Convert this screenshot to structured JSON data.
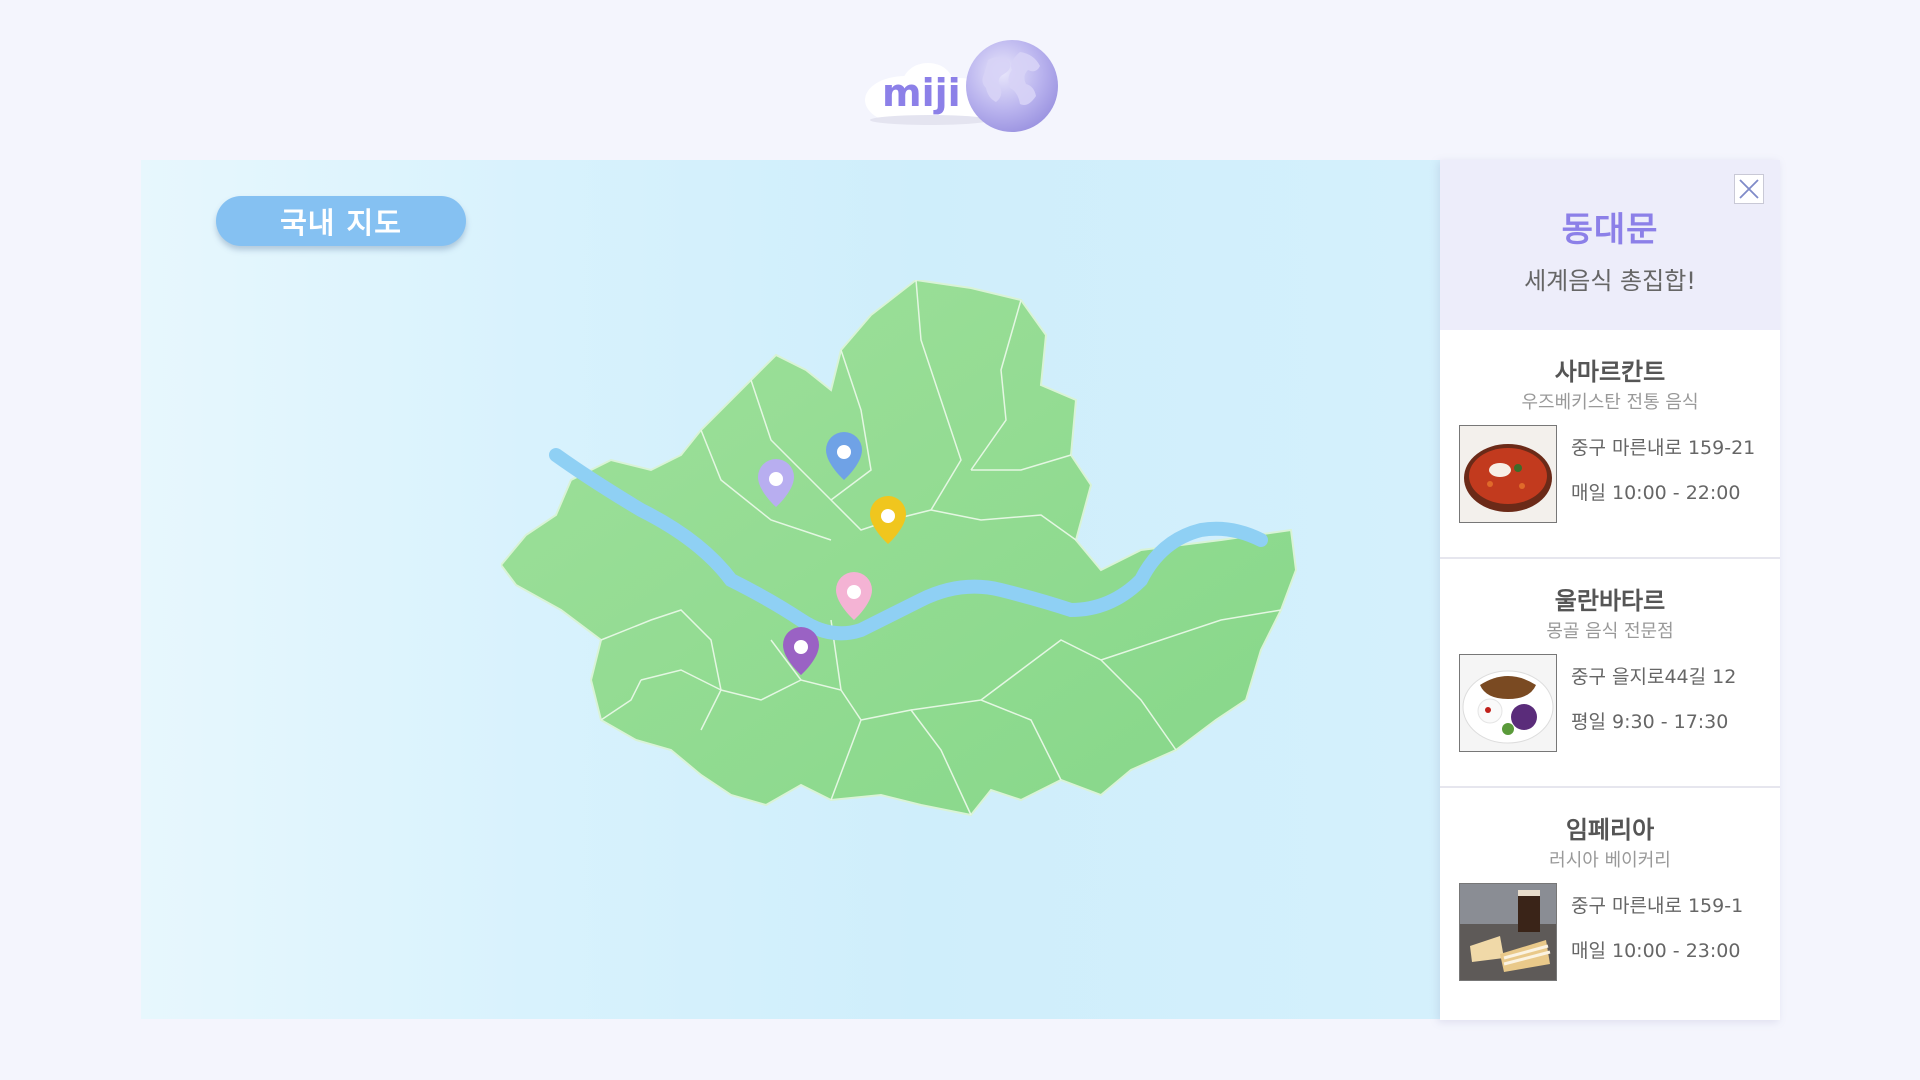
{
  "brand": {
    "logo_text": "miji",
    "accent": "#8c80e8"
  },
  "map": {
    "tab_label": "국내 지도",
    "region": "Seoul",
    "pins": [
      "lavender",
      "blue",
      "yellow",
      "pink",
      "purple"
    ]
  },
  "detail": {
    "title": "동대문",
    "subtitle": "세계음식 총집합!",
    "close_icon": "close-icon",
    "restaurants": [
      {
        "name": "사마르칸트",
        "desc": "우즈베키스탄 전통 음식",
        "address": "중구 마른내로 159-21",
        "hours": "매일 10:00 - 22:00"
      },
      {
        "name": "울란바타르",
        "desc": "몽골 음식 전문점",
        "address": "중구 을지로44길 12",
        "hours": "평일 9:30 - 17:30"
      },
      {
        "name": "임페리아",
        "desc": "러시아 베이커리",
        "address": "중구 마른내로 159-1",
        "hours": "매일 10:00 - 23:00"
      }
    ]
  }
}
